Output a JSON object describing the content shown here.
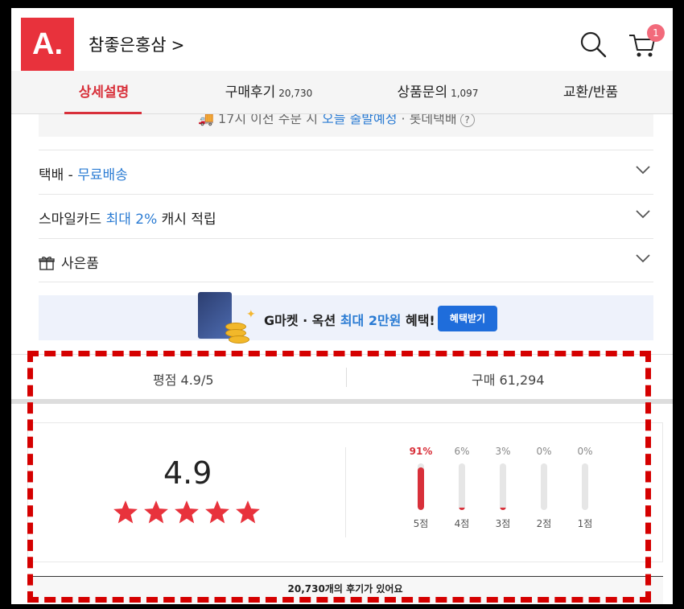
{
  "header": {
    "logo_text": "A.",
    "store_name": "참좋은홍삼",
    "chevron": ">",
    "cart_count": "1"
  },
  "tabs": [
    {
      "label": "상세설명",
      "count": ""
    },
    {
      "label": "구매후기",
      "count": "20,730"
    },
    {
      "label": "상품문의",
      "count": "1,097"
    },
    {
      "label": "교환/반품",
      "count": ""
    }
  ],
  "delivery_notice": {
    "prefix": "17시 이전 주문 시 ",
    "highlight": "오늘 출발예정",
    "suffix": " · 롯데택배"
  },
  "rows": [
    {
      "prefix": "택배 - ",
      "accent": "무료배송",
      "suffix": ""
    },
    {
      "prefix": "스마일카드 ",
      "accent": "최대 2%",
      "suffix": " 캐시 적립"
    },
    {
      "prefix": "",
      "accent": "",
      "suffix": "사은품"
    }
  ],
  "banner": {
    "text_prefix": "G마켓 · 옥션 ",
    "text_accent": "최대 2만원",
    "text_suffix": " 혜택!",
    "button_label": "혜택받기"
  },
  "stats": {
    "rating_label": "평점 4.9/5",
    "purchase_label": "구매 61,294"
  },
  "rating": {
    "score": "4.9",
    "stars": 5,
    "distribution": [
      {
        "pct_label": "91%",
        "value": 91,
        "label": "5점"
      },
      {
        "pct_label": "6%",
        "value": 6,
        "label": "4점"
      },
      {
        "pct_label": "3%",
        "value": 3,
        "label": "3점"
      },
      {
        "pct_label": "0%",
        "value": 0,
        "label": "2점"
      },
      {
        "pct_label": "0%",
        "value": 0,
        "label": "1점"
      }
    ]
  },
  "reviews_summary": "20,730개의 후기가 있어요",
  "colors": {
    "brand": "#e8323c",
    "accent_blue": "#2a7bd3",
    "highlight_red": "#d50000"
  }
}
